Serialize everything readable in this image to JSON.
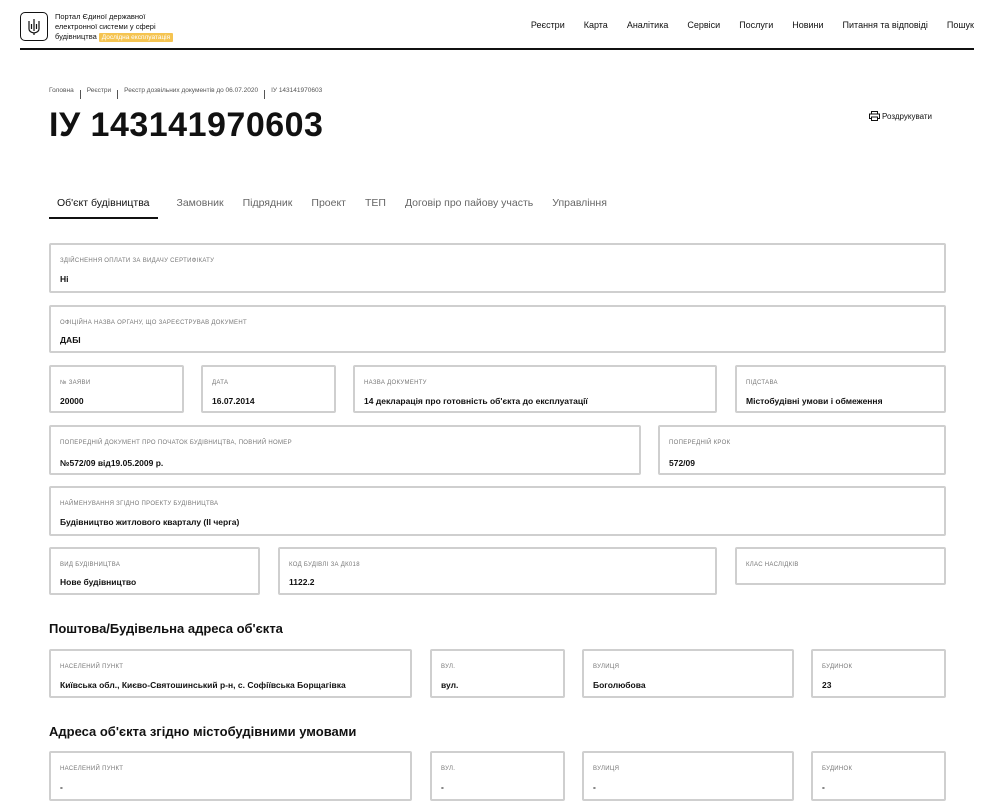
{
  "header": {
    "portal_line1": "Портал Єдиної державної",
    "portal_line2": "електронної системи у сфері",
    "portal_line3": "будівництва",
    "badge": "Дослідна експлуатація",
    "nav": [
      "Реєстри",
      "Карта",
      "Аналітика",
      "Сервіси",
      "Послуги",
      "Новини",
      "Питання та відповіді",
      "Пошук"
    ]
  },
  "breadcrumb": [
    "Головна",
    "Реєстри",
    "Реєстр дозвільних документів до 06.07.2020",
    "ІУ 143141970603"
  ],
  "title": "ІУ 143141970603",
  "print_label": "Роздрукувати",
  "tabs": [
    "Об'єкт будівництва",
    "Замовник",
    "Підрядник",
    "Проект",
    "ТЕП",
    "Договір про пайову участь",
    "Управління"
  ],
  "fields": {
    "payment": {
      "label": "Здійснення оплати за видачу сертифікату",
      "value": "Ні"
    },
    "authority": {
      "label": "Офіційна назва органу, що зареєстрував документ",
      "value": "ДАБІ"
    },
    "app_no": {
      "label": "№ заяви",
      "value": "20000"
    },
    "date": {
      "label": "Дата",
      "value": "16.07.2014"
    },
    "doc_name": {
      "label": "Назва документу",
      "value": "14 декларація про готовність об'єкта до експлуатації"
    },
    "basis": {
      "label": "Підстава",
      "value": "Містобудівні умови і обмеження"
    },
    "prev_doc": {
      "label": "Попередній документ про початок будівництва, повний номер",
      "value": "№572/09 від19.05.2009 р."
    },
    "prev_step": {
      "label": "Попередній крок",
      "value": "572/09"
    },
    "project_name": {
      "label": "Найменування згідно проекту будівництва",
      "value": "Будівництво житлового кварталу (ІІ черга)"
    },
    "build_type": {
      "label": "Вид будівництва",
      "value": "Нове будівництво"
    },
    "dk018": {
      "label": "Код будівлі за ДК018",
      "value": "1122.2"
    },
    "consequence": {
      "label": "Клас наслідків",
      "value": ""
    }
  },
  "postal_address": {
    "title": "Поштова/Будівельна адреса об'єкта",
    "settlement": {
      "label": "Населений пункт",
      "value": "Київська обл., Києво-Святошинський р-н, с. Софіївська Борщагівка"
    },
    "street_type": {
      "label": "Вул.",
      "value": "вул."
    },
    "street": {
      "label": "Вулиця",
      "value": "Боголюбова"
    },
    "building": {
      "label": "Будинок",
      "value": "23"
    }
  },
  "urban_address": {
    "title": "Адреса об'єкта згідно містобудівними умовами",
    "settlement": {
      "label": "Населений пункт",
      "value": "-"
    },
    "street_type": {
      "label": "Вул.",
      "value": "-"
    },
    "street": {
      "label": "Вулиця",
      "value": "-"
    },
    "building": {
      "label": "Будинок",
      "value": "-"
    }
  }
}
